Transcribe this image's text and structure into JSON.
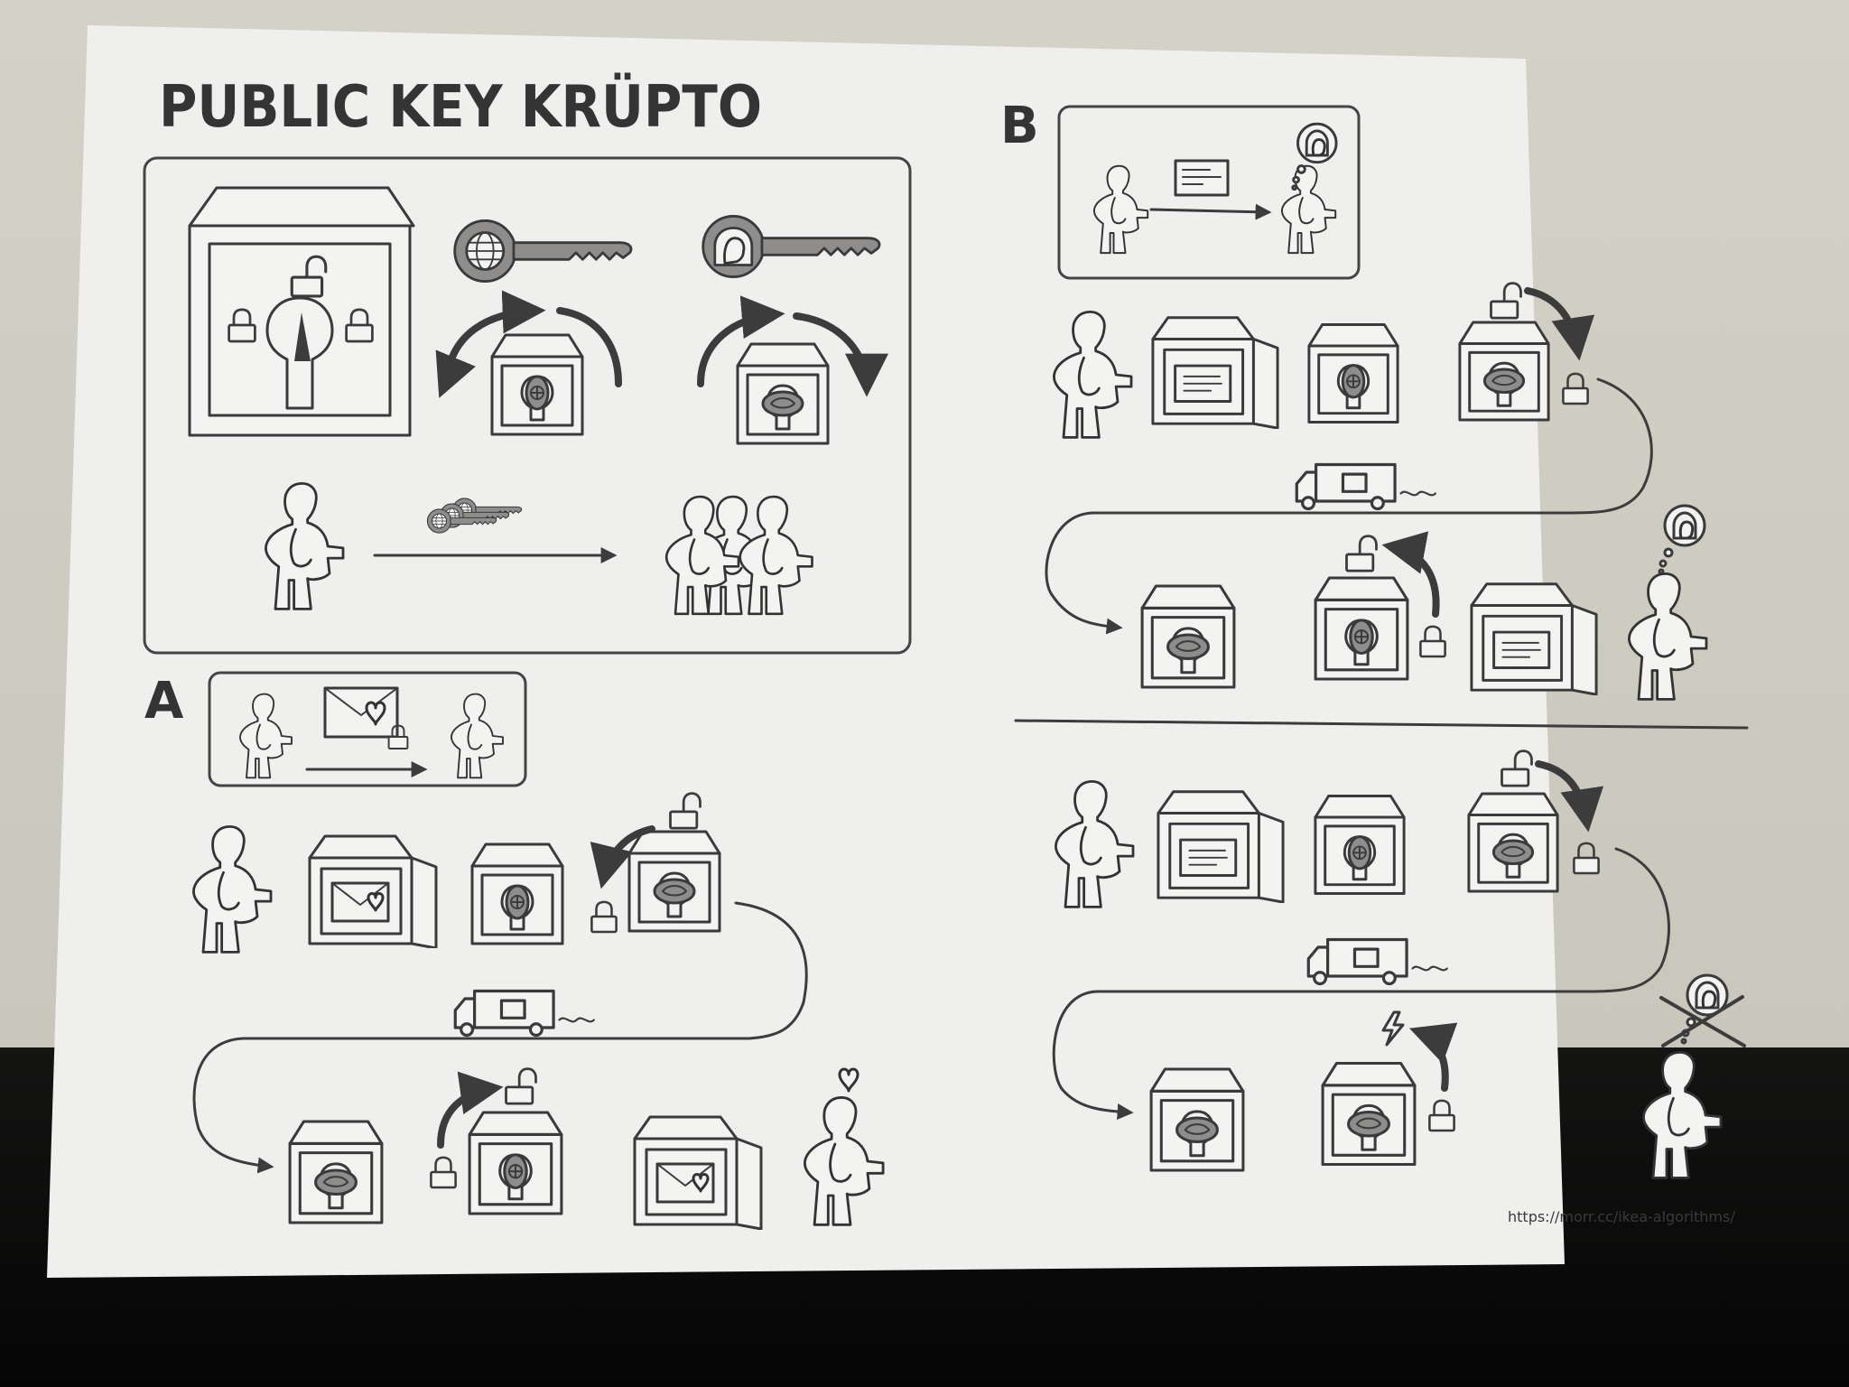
{
  "title": "PUBLIC KEY KRÜPTO",
  "section_a_label": "A",
  "section_b_label": "B",
  "url": "https://morr.cc/ikea-algorithms/",
  "colors": {
    "paper": "#efefee",
    "ink": "#3a3a3a",
    "key_grey": "#8f8d8b",
    "wall": "#cecbc0",
    "desk": "#0b0b0b"
  },
  "icons": [
    "safe-icon",
    "padlock-icon",
    "public-key-icon",
    "private-key-icon",
    "keyhole-box-icon",
    "person-icon",
    "delivery-truck-icon",
    "envelope-heart-icon",
    "document-icon",
    "lightning-icon",
    "heart-icon",
    "thought-bubble-icon",
    "rotate-arrow-icon"
  ]
}
